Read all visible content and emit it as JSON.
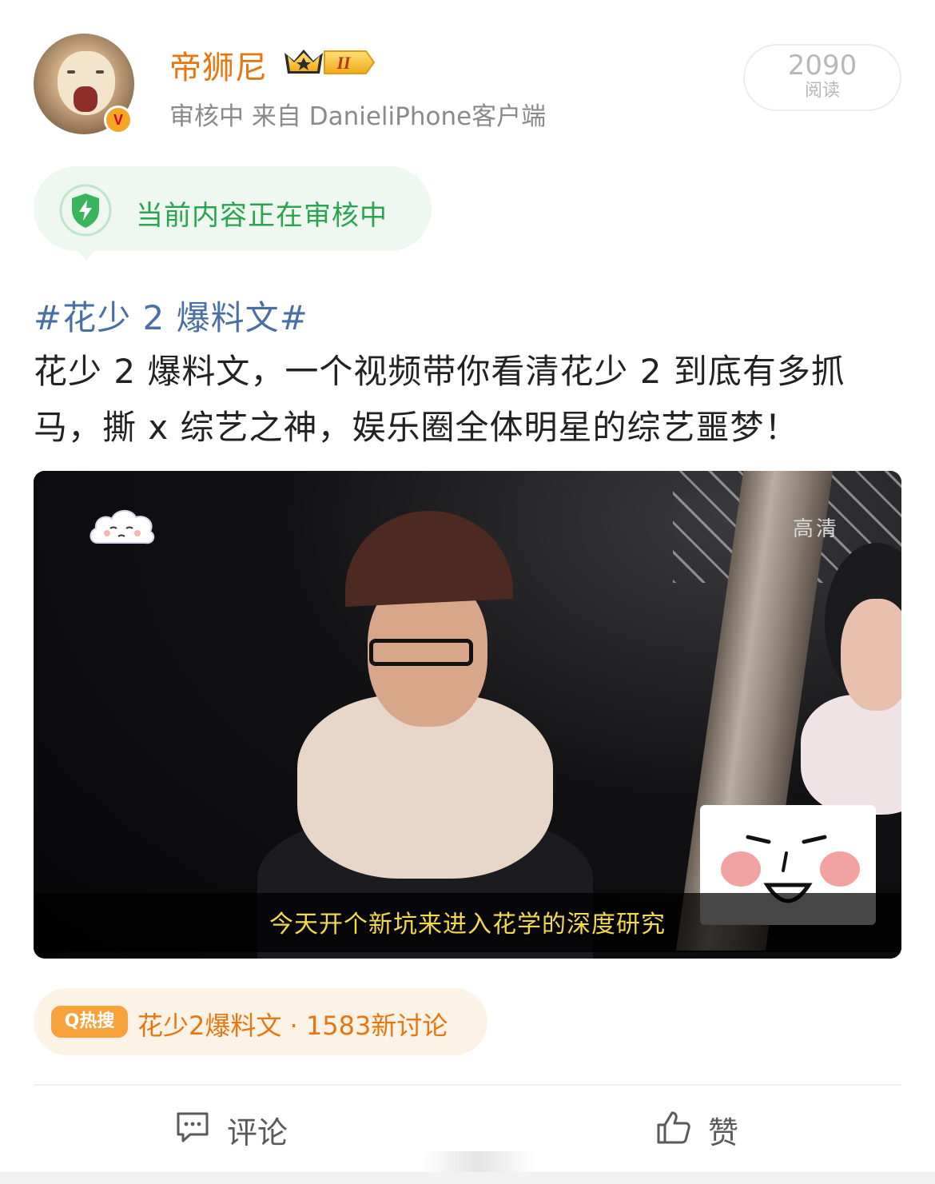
{
  "post": {
    "username": "帝狮尼",
    "rank_badge": "II",
    "verified_mark": "V",
    "meta": "审核中  来自 DanieliPhone客户端",
    "reads": {
      "count": "2090",
      "label": "阅读"
    }
  },
  "review_notice": {
    "icon": "shield-bolt-icon",
    "text": "当前内容正在审核中"
  },
  "content": {
    "hashtag": "#花少 2 爆料文#",
    "text": "花少 2 爆料文，一个视频带你看清花少 2 到底有多抓马，撕 x 综艺之神，娱乐圈全体明星的综艺噩梦！"
  },
  "video": {
    "quality_label": "高清",
    "subtitle": "今天开个新坑来进入花学的深度研究"
  },
  "hot_search": {
    "tag": "Q热搜",
    "text": "花少2爆料文 · 1583新讨论"
  },
  "actions": {
    "comment": {
      "label": "评论",
      "icon": "comment-icon"
    },
    "like": {
      "label": "赞",
      "icon": "thumbs-up-icon"
    }
  },
  "colors": {
    "username": "#e8760f",
    "hashtag": "#4a6fa5",
    "review_green": "#2aa44f",
    "hot_orange": "#e8760f"
  }
}
